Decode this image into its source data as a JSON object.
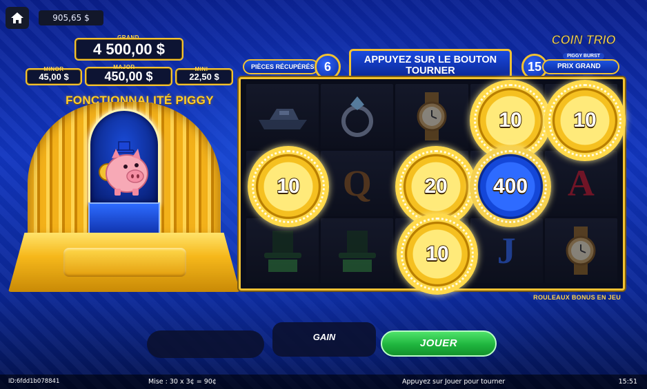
{
  "topbar": {
    "home_icon": "home-icon",
    "balance": "905,65 $"
  },
  "jackpots": {
    "grand_label": "GRAND",
    "grand_value": "4 500,00 $",
    "minor_label": "MINOR",
    "minor_value": "45,00 $",
    "major_label": "MAJOR",
    "major_value": "450,00 $",
    "mini_label": "MINI",
    "mini_value": "22,50 $"
  },
  "feature_title": "FONCTIONNALITÉ PIGGY",
  "logo": {
    "main": "COIN TRIO",
    "sub": "PIGGY BURST"
  },
  "header": {
    "coins_label": "PIÈCES RÉCUPÉRÉS",
    "coins_count": "6",
    "message": "APPUYEZ SUR LE BOUTON TOURNER",
    "grand_count": "15",
    "grand_label": "PRIX GRAND"
  },
  "reels": {
    "rows": [
      [
        "boat-icon",
        "ring-icon",
        "watch-icon",
        "coin",
        "coin"
      ],
      [
        "coin",
        "Q",
        "coin",
        "coin",
        "A"
      ],
      [
        "top-hat-icon",
        "top-hat-icon",
        "coin",
        "J",
        "watch-icon"
      ]
    ],
    "coins": [
      {
        "value": "10",
        "color": "gold"
      },
      {
        "value": "10",
        "color": "gold"
      },
      {
        "value": "10",
        "color": "gold"
      },
      {
        "value": "20",
        "color": "gold"
      },
      {
        "value": "400",
        "color": "blue"
      },
      {
        "value": "10",
        "color": "gold"
      }
    ]
  },
  "bonus_label": "ROULEAUX BONUS EN JEU",
  "controls": {
    "gain_label": "GAIN",
    "play_label": "JOUER"
  },
  "footer": {
    "id": "ID:6fdd1b078841",
    "bet": "Mise : 30 x 3¢ = 90¢",
    "status": "Appuyez sur Jouer pour tourner",
    "time": "15:51"
  },
  "colors": {
    "gold": "#f2c232",
    "play_green": "#1fb53e",
    "background_blue": "#1236c0"
  }
}
